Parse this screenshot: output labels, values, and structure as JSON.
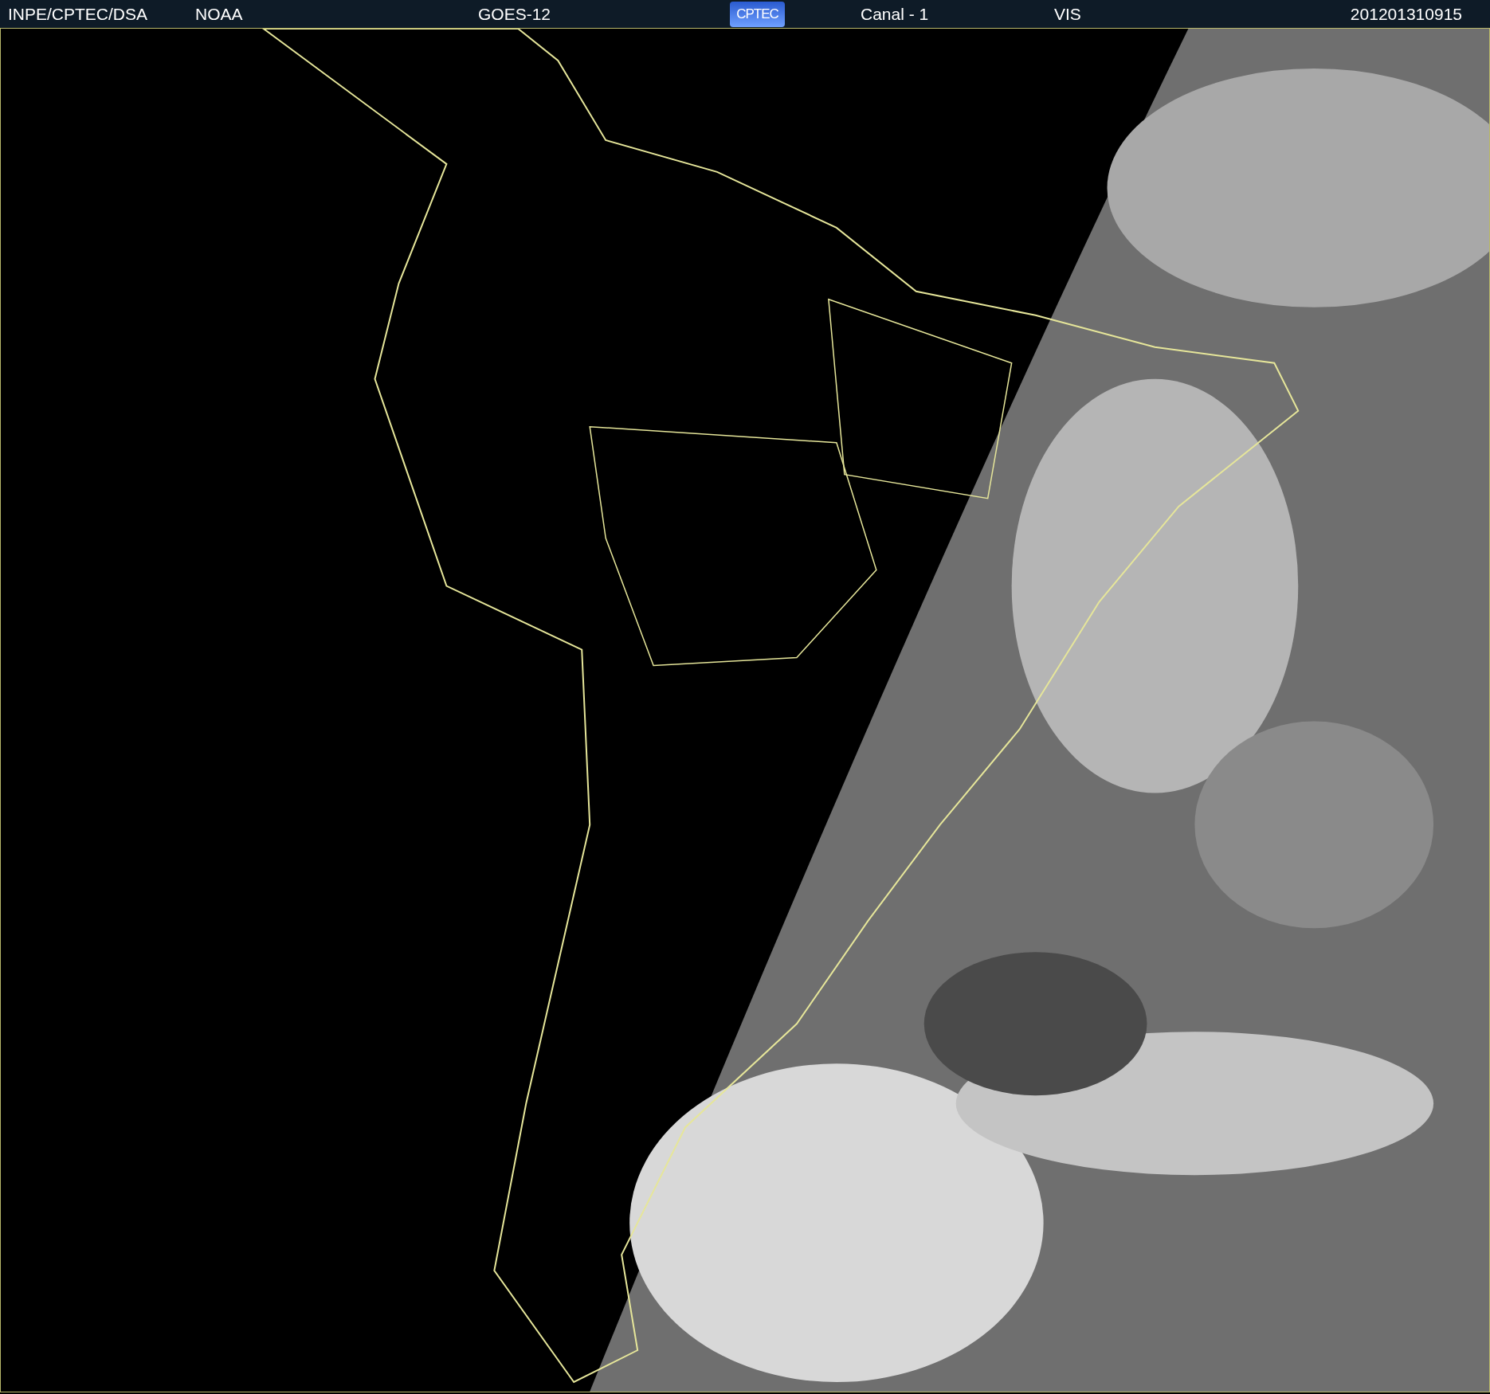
{
  "header": {
    "source": "INPE/CPTEC/DSA",
    "agency": "NOAA",
    "satellite": "GOES-12",
    "logo": "CPTEC",
    "channel": "Canal - 1",
    "band": "VIS",
    "timestamp": "201201310915"
  }
}
